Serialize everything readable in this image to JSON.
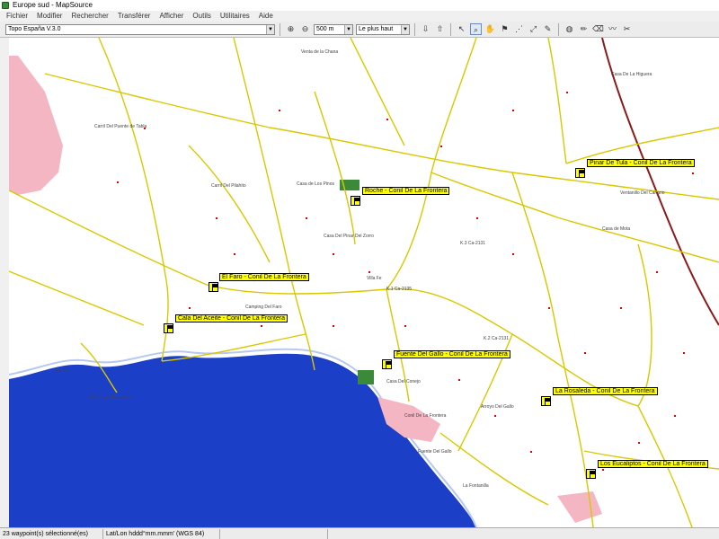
{
  "window": {
    "title": "Europe sud - MapSource"
  },
  "menu": [
    "Fichier",
    "Modifier",
    "Rechercher",
    "Transférer",
    "Afficher",
    "Outils",
    "Utilitaires",
    "Aide"
  ],
  "toolbar": {
    "product": "Topo España V.3.0",
    "zoom": "500 m",
    "detail": "Le plus haut",
    "icons": [
      "zoom-in-icon",
      "zoom-out-icon",
      "receive-device-icon",
      "send-device-icon",
      "select-tool-icon",
      "zoom-tool-icon",
      "hand-tool-icon",
      "waypoint-tool-icon",
      "route-tool-icon",
      "distance-tool-icon",
      "track-tool-icon",
      "google-earth-icon"
    ]
  },
  "map": {
    "waypoints": [
      {
        "name": "Roche - Conil De La Frontera"
      },
      {
        "name": "Pinar De Tula - Conil De La Frontera"
      },
      {
        "name": "El Faro - Conil De La Frontera"
      },
      {
        "name": "Cala Del Aceite - Conil De La Frontera"
      },
      {
        "name": "Fuente Del Gallo - Conil De La Frontera"
      },
      {
        "name": "La Rosaleda - Conil De La Frontera"
      },
      {
        "name": "Los Eucaliptos - Conil De La Frontera"
      }
    ],
    "labels": [
      "Carril Del Puente de Tabla",
      "Carril Del Pilahito",
      "Casa Del Pinar Del Zorro",
      "Roche",
      "Puerto de Almadraba",
      "Camping Del Faro",
      "Conil De La Frontera",
      "Fuente Del Gallo",
      "La Fontanilla",
      "Casa de Los Pinos",
      "Venta de la Chana",
      "Casa de Mota",
      "Ventanillo Del Canario",
      "K.1 Ca-2135",
      "K.3 Ca-2131",
      "K.2 Ca-2131",
      "Arroyo Del Gallo",
      "Villa Fe",
      "Casa Del Conejo",
      "Casa De La Higuera"
    ]
  },
  "status": {
    "selection": "23 waypoint(s) sélectionné(es)",
    "position": "Lat/Lon hddd°mm.mmm' (WGS 84)"
  },
  "colors": {
    "road": "#d8c800",
    "waypoint_fill": "#ffff00",
    "urban": "#f4b6c2",
    "sea": "#1c3fc8",
    "railway": "#8b1a1a",
    "poi": "#e00000"
  }
}
